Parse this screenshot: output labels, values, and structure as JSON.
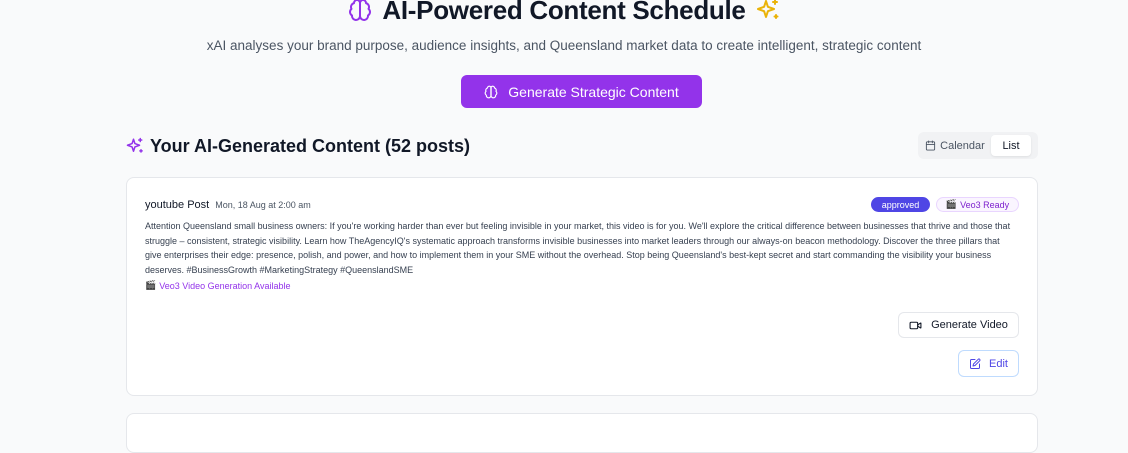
{
  "hero": {
    "title": "AI-Powered Content Schedule",
    "subtitle": "xAI analyses your brand purpose, audience insights, and Queensland market data to create intelligent, strategic content",
    "generate_label": "Generate Strategic Content"
  },
  "section": {
    "title": "Your AI-Generated Content (52 posts)"
  },
  "view_toggle": {
    "calendar_label": "Calendar",
    "list_label": "List",
    "selected": "List"
  },
  "post": {
    "platform": "youtube Post",
    "date": "Mon, 18 Aug at 2:00 am",
    "status": "approved",
    "veo_badge": "Veo3 Ready",
    "veo_badge_emoji": "🎬",
    "body": "Attention Queensland small business owners: If you're working harder than ever but feeling invisible in your market, this video is for you. We'll explore the critical difference between businesses that thrive and those that struggle – consistent, strategic visibility. Learn how TheAgencyIQ's systematic approach transforms invisible businesses into market leaders through our always-on beacon methodology. Discover the three pillars that give enterprises their edge: presence, polish, and power, and how to implement them in your SME without the overhead. Stop being Queensland's best-kept secret and start commanding the visibility your business deserves. #BusinessGrowth #MarketingStrategy #QueenslandSME",
    "veo_available_emoji": "🎬",
    "veo_available_label": "Veo3 Video Generation Available",
    "generate_video_label": "Generate Video",
    "edit_label": "Edit"
  },
  "icons": {
    "title_icon": "brain-icon",
    "title_sparkle": "sparkles-icon",
    "button_icon": "brain-icon",
    "section_icon": "sparkles-icon",
    "calendar_icon": "calendar-icon",
    "video_icon": "video-camera-icon",
    "edit_icon": "edit-icon"
  },
  "colors": {
    "brand_purple": "#9333ea",
    "approved_badge": "#4f46e5",
    "sparkle_yellow": "#eab308",
    "background": "#f9fafb"
  }
}
